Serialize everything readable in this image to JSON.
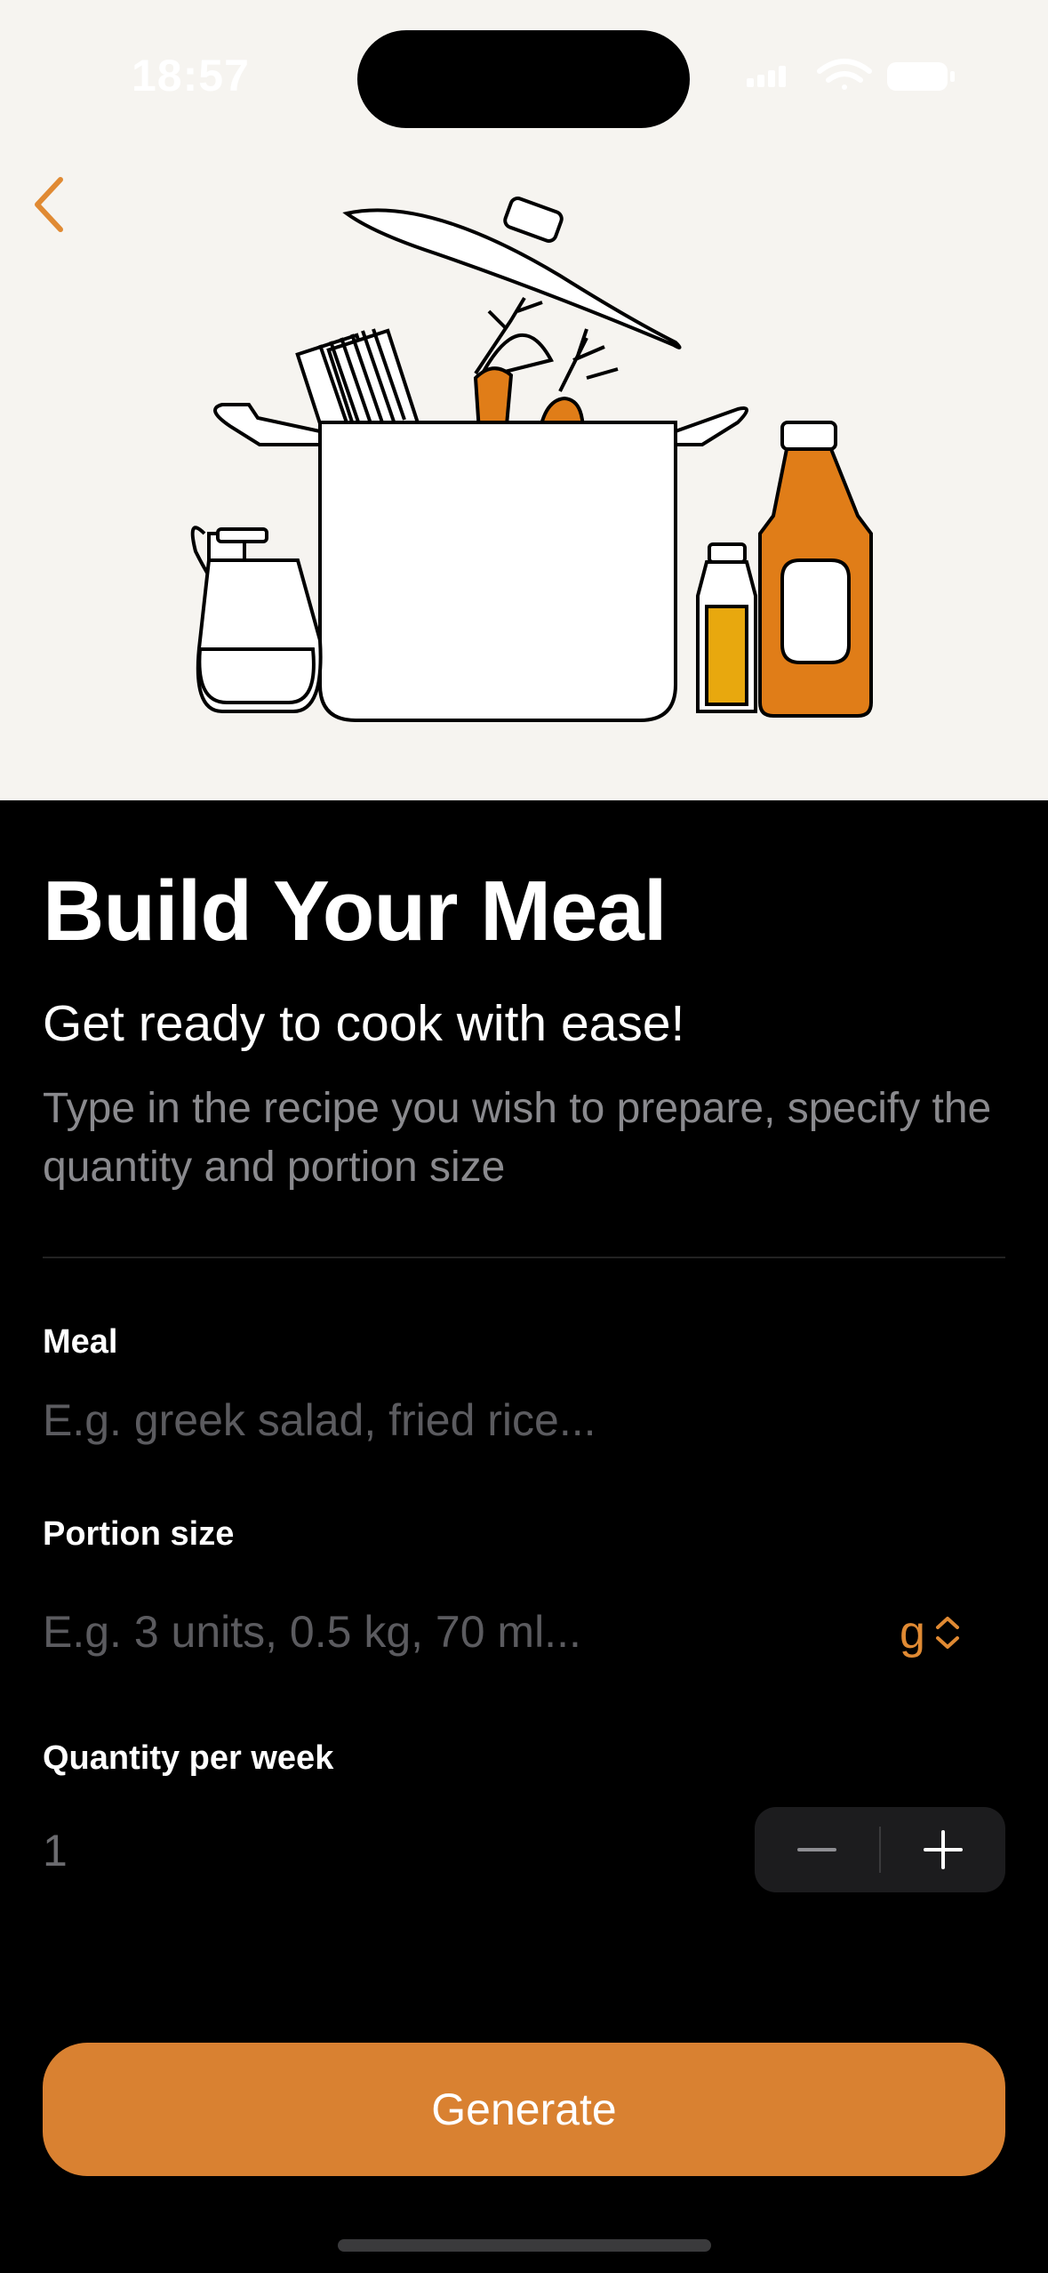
{
  "status": {
    "time": "18:57"
  },
  "header": {
    "back_icon": "chevron-left-icon",
    "accent": "#e08a33"
  },
  "main": {
    "title": "Build Your Meal",
    "subtitle": "Get ready to cook with ease!",
    "description": "Type in the recipe you wish to prepare, specify the quantity and portion size"
  },
  "form": {
    "meal": {
      "label": "Meal",
      "value": "",
      "placeholder": "E.g. greek salad, fried rice..."
    },
    "portion": {
      "label": "Portion size",
      "value": "",
      "placeholder": "E.g. 3 units, 0.5 kg, 70 ml...",
      "unit": "g"
    },
    "quantity": {
      "label": "Quantity per week",
      "value": "1"
    }
  },
  "actions": {
    "generate_label": "Generate",
    "button_color": "#d98131"
  }
}
